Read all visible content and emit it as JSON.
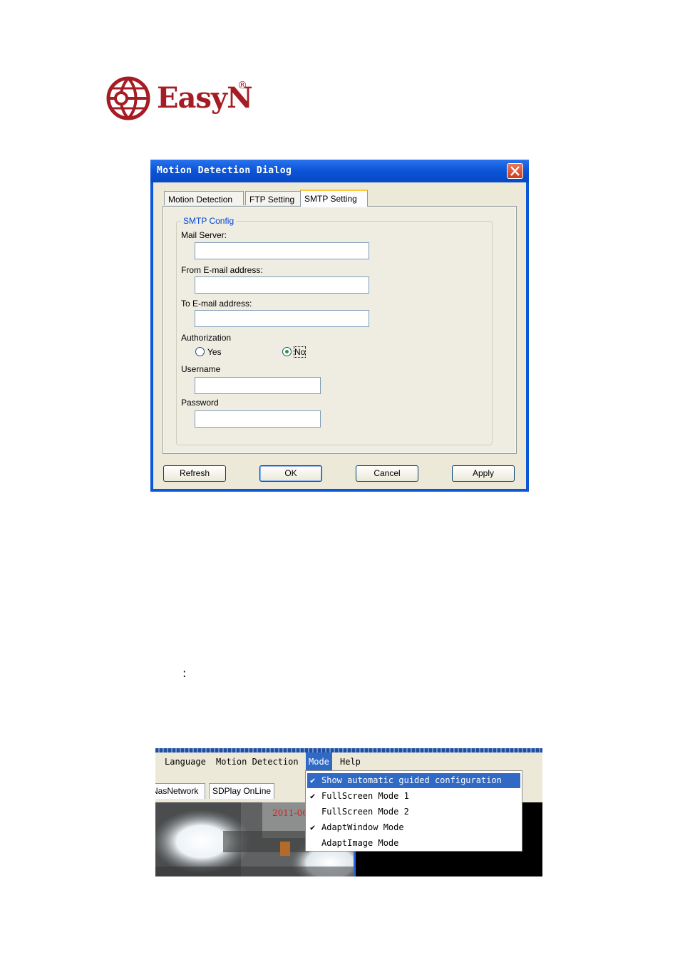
{
  "logo": {
    "text": "EasyN",
    "reg": "®",
    "color": "#a51c24"
  },
  "dialog": {
    "title": "Motion Detection Dialog",
    "tabs": [
      "Motion Detection",
      "FTP Setting",
      "SMTP Setting"
    ],
    "active_tab": "SMTP Setting",
    "group_label": "SMTP Config",
    "labels": {
      "mail_server": "Mail Server:",
      "from_email": "From E-mail address:",
      "to_email": "To E-mail address:",
      "authorization": "Authorization",
      "username": "Username",
      "password": "Password"
    },
    "fields": {
      "mail_server": "",
      "from_email": "",
      "to_email": "",
      "username": "",
      "password": ""
    },
    "radio": {
      "yes": "Yes",
      "no": "No",
      "selected": "No"
    },
    "buttons": {
      "refresh": "Refresh",
      "ok": "OK",
      "cancel": "Cancel",
      "apply": "Apply"
    }
  },
  "note": {
    "colon": ":"
  },
  "app2": {
    "menus": [
      "Language",
      "Motion Detection",
      "Mode",
      "Help"
    ],
    "selected_menu": "Mode",
    "tabs": [
      "NasNetwork",
      "SDPlay OnLine"
    ],
    "timestamp": "2011-06",
    "mode_menu": [
      {
        "label": "Show automatic guided configuration",
        "checked": true,
        "highlighted": true
      },
      {
        "label": "FullScreen Mode 1",
        "checked": true,
        "highlighted": false
      },
      {
        "label": "FullScreen Mode 2",
        "checked": false,
        "highlighted": false
      },
      {
        "label": "AdaptWindow Mode",
        "checked": true,
        "highlighted": false
      },
      {
        "label": "AdaptImage Mode",
        "checked": false,
        "highlighted": false
      }
    ]
  }
}
